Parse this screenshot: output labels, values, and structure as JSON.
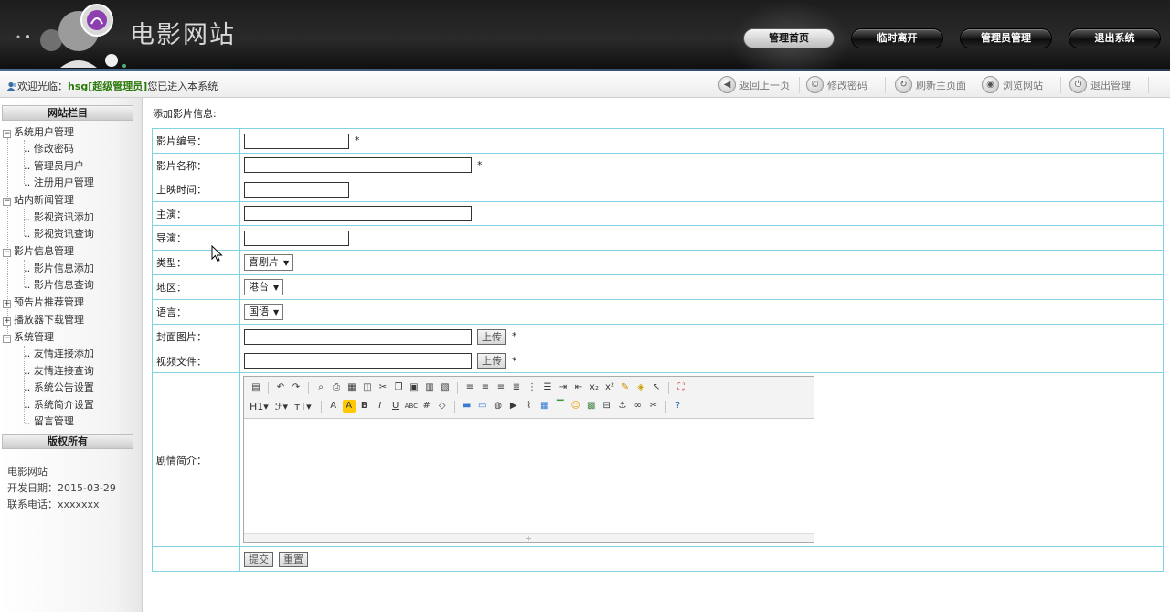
{
  "header": {
    "site_title": "电影网站",
    "nav": [
      "管理首页",
      "临时离开",
      "管理员管理",
      "退出系统"
    ]
  },
  "infobar": {
    "welcome_prefix": "欢迎光临：",
    "user": "hsg[超级管理员]",
    "welcome_suffix": "您已进入本系统",
    "tools": [
      "返回上一页",
      "修改密码",
      "刷新主页面",
      "浏览网站",
      "退出管理"
    ]
  },
  "sidebar": {
    "heading": "网站栏目",
    "groups": [
      {
        "label": "系统用户管理",
        "items": [
          "修改密码",
          "管理员用户",
          "注册用户管理"
        ]
      },
      {
        "label": "站内新闻管理",
        "items": [
          "影视资讯添加",
          "影视资讯查询"
        ]
      },
      {
        "label": "影片信息管理",
        "items": [
          "影片信息添加",
          "影片信息查询"
        ]
      },
      {
        "label": "预告片推荐管理",
        "items": []
      },
      {
        "label": "播放器下载管理",
        "items": []
      },
      {
        "label": "系统管理",
        "items": [
          "友情连接添加",
          "友情连接查询",
          "系统公告设置",
          "系统简介设置",
          "留言管理"
        ]
      }
    ],
    "copyright_heading": "版权所有",
    "copyright_lines": [
      "电影网站",
      "开发日期：2015-03-29",
      "联系电话：xxxxxxx"
    ]
  },
  "main": {
    "title": "添加影片信息:",
    "fields": {
      "code": {
        "label": "影片编号：",
        "value": "",
        "required": "*"
      },
      "name": {
        "label": "影片名称：",
        "value": "",
        "required": "*"
      },
      "release": {
        "label": "上映时间：",
        "value": ""
      },
      "actors": {
        "label": "主演：",
        "value": ""
      },
      "director": {
        "label": "导演：",
        "value": ""
      },
      "type": {
        "label": "类型：",
        "selected": "喜剧片"
      },
      "region": {
        "label": "地区：",
        "selected": "港台"
      },
      "language": {
        "label": "语言：",
        "selected": "国语"
      },
      "cover": {
        "label": "封面图片：",
        "value": "",
        "button": "上传",
        "required": "*"
      },
      "video": {
        "label": "视频文件：",
        "value": "",
        "button": "上传",
        "required": "*"
      },
      "synopsis": {
        "label": "剧情简介："
      }
    },
    "editor": {
      "heading_drop": "H1",
      "font_drop": "ℱ",
      "size_drop": "тT"
    },
    "submit_label": "提交",
    "reset_label": "重置"
  }
}
